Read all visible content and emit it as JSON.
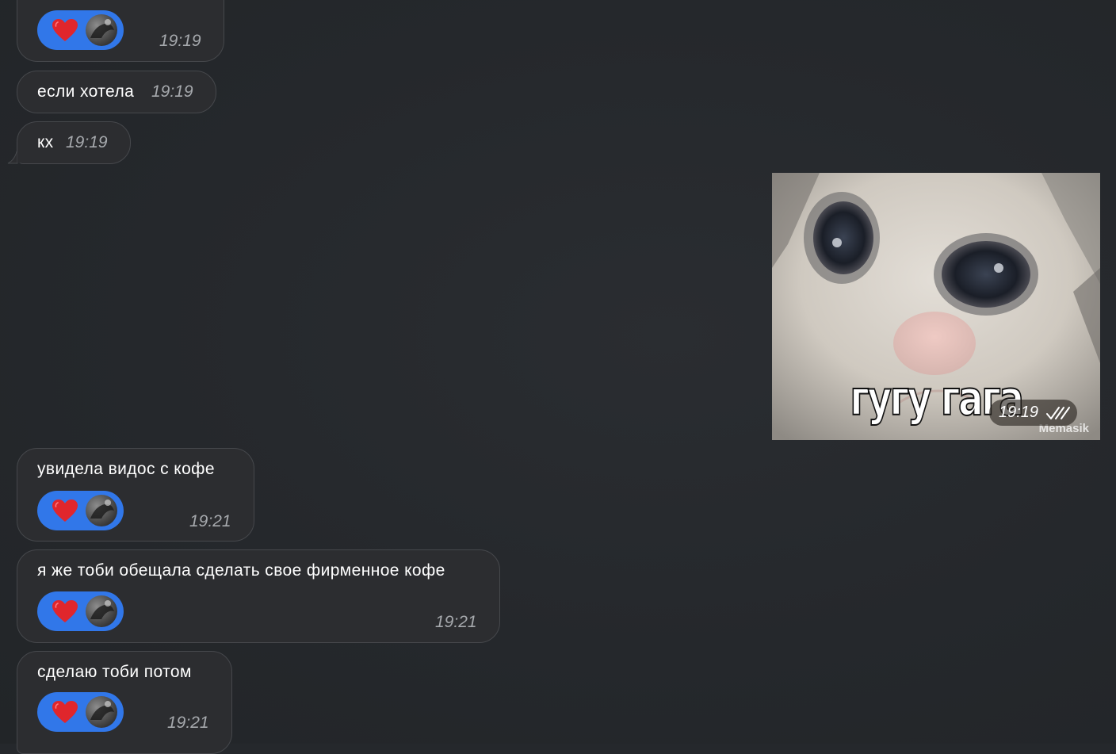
{
  "colors": {
    "background": "#25282c",
    "bubble": "#2c2d30",
    "bubble_border": "#46484c",
    "reaction": "#3177e9",
    "heart": "#e0262c",
    "time_text": "#a6a9ad"
  },
  "messages": [
    {
      "text": "",
      "time": "19:19",
      "reaction": "heart-icon"
    },
    {
      "text": "если хотела",
      "time": "19:19"
    },
    {
      "text": "кх",
      "time": "19:19"
    },
    {
      "text": "увидела видос с кофе",
      "time": "19:21",
      "reaction": "heart-icon"
    },
    {
      "text": "я же тоби обещала сделать свое фирменное кофе",
      "time": "19:21",
      "reaction": "heart-icon"
    },
    {
      "text": "сделаю тоби потом",
      "time": "19:21",
      "reaction": "heart-icon"
    }
  ],
  "image_message": {
    "caption": "гугу гага",
    "watermark": "Memasik",
    "time": "19:19",
    "status_icon": "double-check-icon"
  }
}
